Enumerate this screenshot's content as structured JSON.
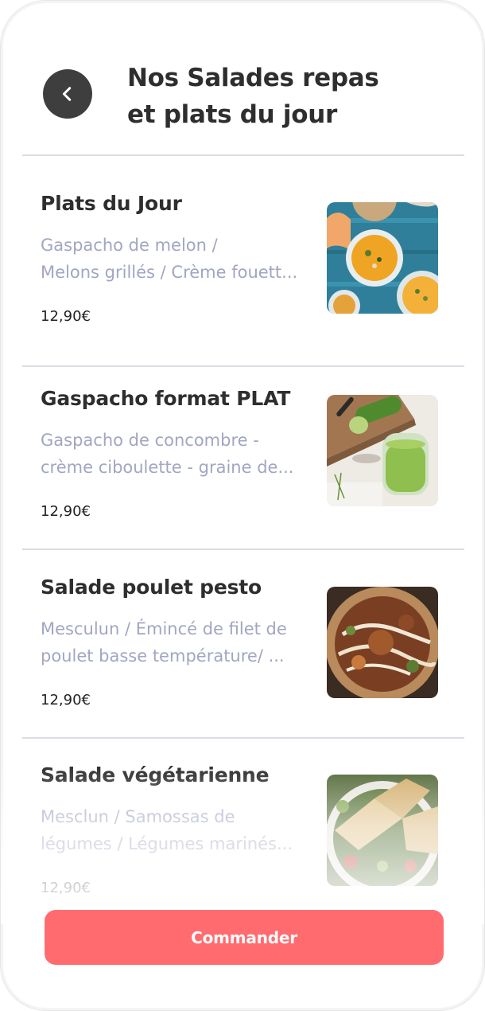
{
  "header": {
    "title": "Nos Salades repas\net plats du jour",
    "back_icon": "chevron-left-icon"
  },
  "items": [
    {
      "name": "Plats du Jour",
      "desc1": "Gaspacho de melon /",
      "desc2": "Melons grillés / Crème fouett...",
      "price": "12,90€"
    },
    {
      "name": "Gaspacho format PLAT",
      "desc1": "Gaspacho de concombre -",
      "desc2": "crème ciboulette - graine de...",
      "price": "12,90€"
    },
    {
      "name": "Salade poulet pesto",
      "desc1": "Mesculun / Émincé de filet de",
      "desc2": "poulet basse température/ ...",
      "price": "12,90€"
    },
    {
      "name": "Salade végétarienne",
      "desc1": "Mesclun / Samossas de",
      "desc2": "légumes  / Légumes marinés...",
      "price": "12,90€"
    }
  ],
  "cta": {
    "label": "Commander"
  },
  "colors": {
    "accent": "#ff6b6f",
    "back_button": "#3e3e3e",
    "description": "#a1a6c2",
    "title": "#2e2e2e"
  }
}
